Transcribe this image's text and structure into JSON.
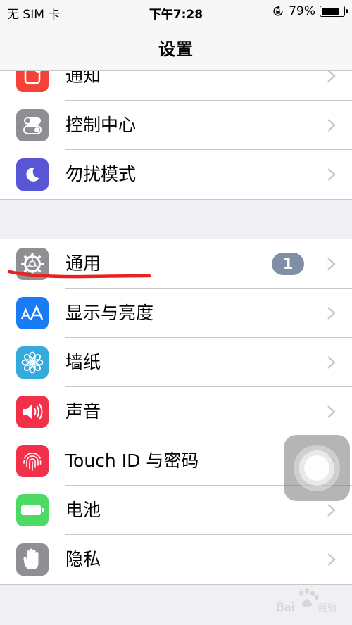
{
  "status_bar": {
    "carrier": "无 SIM 卡",
    "time": "下午7:28",
    "battery_percent_text": "79%",
    "battery_level": 0.79
  },
  "nav": {
    "title": "设置"
  },
  "groups": [
    {
      "items": [
        {
          "label": "通知",
          "icon": "notifications-icon",
          "color": "#f44336"
        },
        {
          "label": "控制中心",
          "icon": "control-center-icon",
          "color": "#8e8e93"
        },
        {
          "label": "勿扰模式",
          "icon": "moon-icon",
          "color": "#5856d6"
        }
      ]
    },
    {
      "items": [
        {
          "label": "通用",
          "icon": "gear-icon",
          "color": "#8e8e93",
          "badge": "1"
        },
        {
          "label": "显示与亮度",
          "icon": "text-size-icon",
          "color": "#1a7cf5"
        },
        {
          "label": "墙纸",
          "icon": "flower-icon",
          "color": "#35aadc"
        },
        {
          "label": "声音",
          "icon": "speaker-icon",
          "color": "#f2304a"
        },
        {
          "label": "Touch ID 与密码",
          "icon": "fingerprint-icon",
          "color": "#f2304a"
        },
        {
          "label": "电池",
          "icon": "battery-icon",
          "color": "#4cd964"
        },
        {
          "label": "隐私",
          "icon": "hand-icon",
          "color": "#8e8e93"
        }
      ]
    }
  ],
  "annotation_color": "#e8231f"
}
